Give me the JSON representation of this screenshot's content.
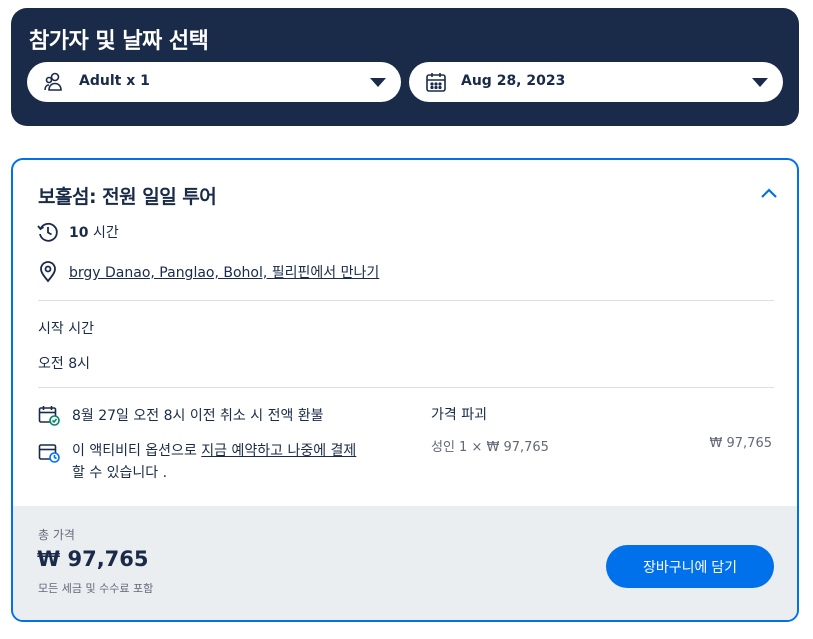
{
  "header": {
    "title": "참가자 및 날짜 선택",
    "participants": {
      "value": "Adult x 1",
      "icon": "participants-icon"
    },
    "date": {
      "value": "Aug 28, 2023",
      "icon": "calendar-icon"
    }
  },
  "option": {
    "title": "보홀섬: 전원 일일 투어",
    "duration": {
      "number": "10",
      "unit": "시간"
    },
    "meeting_point": "brgy Danao, Panglao, Bohol, 필리핀에서 만나기",
    "start_time": {
      "label": "시작 시간",
      "value": "오전 8시"
    },
    "cancellation": "8월 27일 오전 8시 이전 취소 시 전액 환불",
    "reserve": {
      "prefix": "이 액티비티 옵션으로 ",
      "link": "지금 예약하고 나중에 결제",
      "suffix": " 할 수 있습니다 ."
    },
    "breakdown": {
      "title": "가격 파괴",
      "item": "성인 1 × ₩ 97,765",
      "price": "₩ 97,765"
    }
  },
  "footer": {
    "total_label": "총 가격",
    "total_price": "₩ 97,765",
    "note": "모든 세금 및 수수료 포함",
    "cart_button": "장바구니에 담기"
  },
  "colors": {
    "navy": "#1a2b49",
    "accent": "#0071eb",
    "footer_bg": "#ebeef1",
    "muted": "#63687a",
    "success": "#008768"
  }
}
